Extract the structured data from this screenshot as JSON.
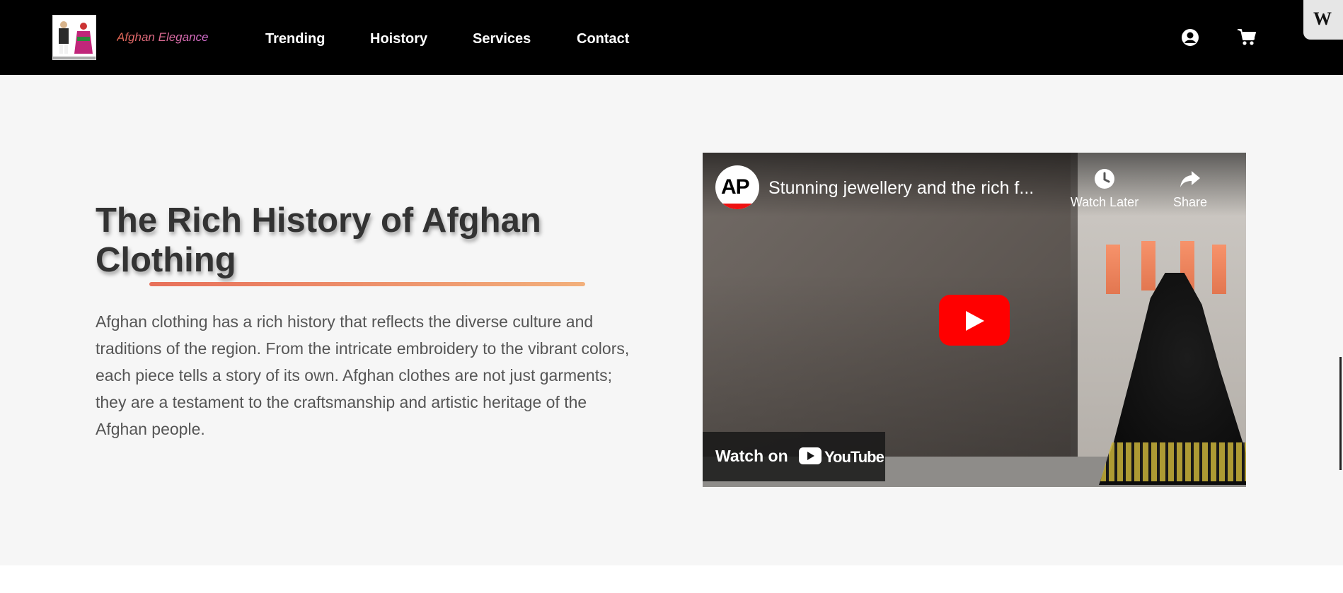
{
  "brand": {
    "name": "Afghan Elegance"
  },
  "nav": {
    "links": [
      "Trending",
      "Hoistory",
      "Services",
      "Contact"
    ]
  },
  "badge": {
    "letter": "W"
  },
  "hero": {
    "title": "The Rich History of Afghan Clothing",
    "description": "Afghan clothing has a rich history that reflects the diverse culture and traditions of the region. From the intricate embroidery to the vibrant colors, each piece tells a story of its own. Afghan clothes are not just garments; they are a testament to the craftsmanship and artistic heritage of the Afghan people."
  },
  "video": {
    "channel_logo": "AP",
    "title": "Stunning jewellery and the rich f...",
    "watch_later_label": "Watch Later",
    "share_label": "Share",
    "watch_on_label": "Watch on",
    "youtube_label": "YouTube"
  },
  "colors": {
    "nav_bg": "#000000",
    "hero_bg": "#f6f6f6",
    "underline_start": "#e8705a",
    "underline_end": "#f2b07c",
    "play_red": "#ff0000"
  },
  "icons": [
    "user-account-icon",
    "shopping-cart-icon",
    "clock-icon",
    "share-icon",
    "play-icon",
    "youtube-icon"
  ]
}
